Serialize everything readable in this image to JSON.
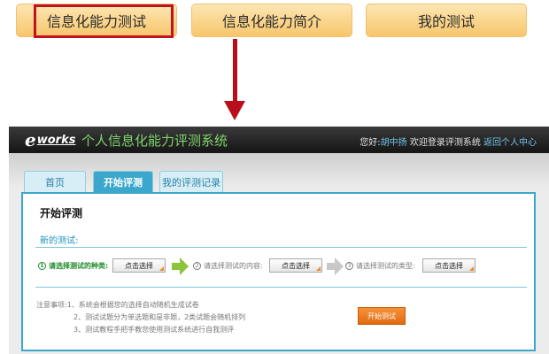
{
  "top_tabs": [
    {
      "label": "信息化能力测试"
    },
    {
      "label": "信息化能力简介"
    },
    {
      "label": "我的测试"
    }
  ],
  "header": {
    "logo_e": "e",
    "logo_works": "works",
    "title": "个人信息化能力评测系统",
    "greeting": "您好:",
    "user_name": "胡中扬",
    "welcome": " 欢迎登录评测系统 ",
    "home_link": "返回个人中心"
  },
  "tabs": [
    {
      "label": "首页"
    },
    {
      "label": "开始评测"
    },
    {
      "label": "我的评测记录"
    }
  ],
  "panel": {
    "title": "开始评测",
    "new_test_label": "新的测试:",
    "steps": [
      {
        "num": "1",
        "label": "请选择测试的种类:",
        "button": "点击选择"
      },
      {
        "num": "2",
        "label": "请选择测试的内容:",
        "button": "点击选择"
      },
      {
        "num": "3",
        "label": "请选择测试的类型:",
        "button": "点击选择"
      }
    ],
    "notes": [
      "注意事项:1、系统会根据您的选择自动随机生成试卷",
      "2、测试试题分为单选题和是非题，2类试题会随机排列",
      "3、测试教程手把手教您使用测试系统进行自我测评"
    ],
    "start_button": "开始测试"
  },
  "colors": {
    "highlight": "#c1121f",
    "arrow": "#b80f1a",
    "accent": "#3ba7cc",
    "start_button": "#e8761c",
    "title_green": "#7fd36b"
  }
}
